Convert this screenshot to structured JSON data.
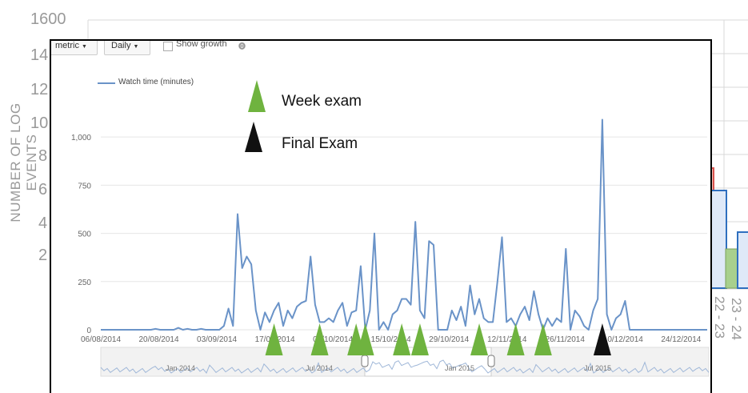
{
  "background_chart": {
    "ylabel": "NUMBER OF LOG EVENTS",
    "yticks": [
      "1600",
      "14",
      "12",
      "10",
      "8",
      "6",
      "4",
      "2"
    ],
    "xticks": [
      "22 - 23",
      "23 - 24"
    ]
  },
  "toolbar": {
    "metric_label": "metric",
    "daily_label": "Daily",
    "show_growth_label": "Show growth"
  },
  "legend": {
    "series_label": "Watch time (minutes)"
  },
  "annotations": {
    "week_exam_label": "Week exam",
    "final_exam_label": "Final Exam"
  },
  "colors": {
    "line": "#6a93c8",
    "week_exam_marker": "#6fb33f",
    "final_exam_marker": "#111111"
  },
  "overview": {
    "labels": [
      "Jan 2014",
      "Jul 2014",
      "Jan 2015",
      "Jul 2015"
    ]
  },
  "chart_data": {
    "type": "line",
    "title": "",
    "series": [
      {
        "name": "Watch time (minutes)",
        "values": [
          0,
          0,
          0,
          0,
          0,
          0,
          0,
          0,
          0,
          0,
          0,
          0,
          5,
          0,
          0,
          0,
          0,
          10,
          0,
          5,
          0,
          0,
          5,
          0,
          0,
          0,
          0,
          20,
          110,
          20,
          600,
          320,
          380,
          340,
          100,
          0,
          90,
          40,
          100,
          140,
          20,
          100,
          60,
          120,
          140,
          150,
          380,
          130,
          40,
          40,
          60,
          40,
          100,
          140,
          20,
          90,
          100,
          330,
          0,
          100,
          500,
          0,
          40,
          0,
          80,
          100,
          160,
          160,
          130,
          560,
          100,
          60,
          460,
          440,
          0,
          0,
          0,
          100,
          50,
          120,
          20,
          230,
          80,
          160,
          60,
          40,
          40,
          250,
          480,
          40,
          60,
          20,
          80,
          120,
          50,
          200,
          80,
          0,
          60,
          20,
          60,
          40,
          420,
          0,
          100,
          70,
          20,
          0,
          100,
          160,
          1090,
          80,
          0,
          60,
          80,
          150,
          0,
          0,
          0,
          0,
          0,
          0,
          0,
          0,
          0,
          0,
          0,
          0,
          0,
          0,
          0,
          0,
          0,
          0
        ]
      }
    ],
    "x_start": "06/08/2014",
    "x_end": "31/12/2014",
    "xticks": [
      "06/08/2014",
      "20/08/2014",
      "03/09/2014",
      "17/09/2014",
      "01/10/2014",
      "15/10/2014",
      "29/10/2014",
      "12/11/2014",
      "26/11/2014",
      "10/12/2014",
      "24/12/2014"
    ],
    "xticks_visible": [
      "06/08/2014",
      "20/08/2014",
      "03/09/2014",
      "/09/2014",
      "1/10/201",
      "5/10/2014",
      "9/10/2014",
      "12/",
      "/2014",
      "/11/201",
      "10/12/2014",
      "24/12/2014"
    ],
    "yticks": [
      0,
      250,
      500,
      750,
      1000
    ],
    "ytick_labels": [
      "0",
      "250",
      "500",
      "750",
      "1,000"
    ],
    "ylim": [
      0,
      1200
    ],
    "week_exam_positions": [
      38,
      48,
      56,
      58,
      66,
      70,
      83,
      91,
      97
    ],
    "final_exam_positions": [
      110
    ],
    "grid": true,
    "legend_position": "top-left"
  }
}
